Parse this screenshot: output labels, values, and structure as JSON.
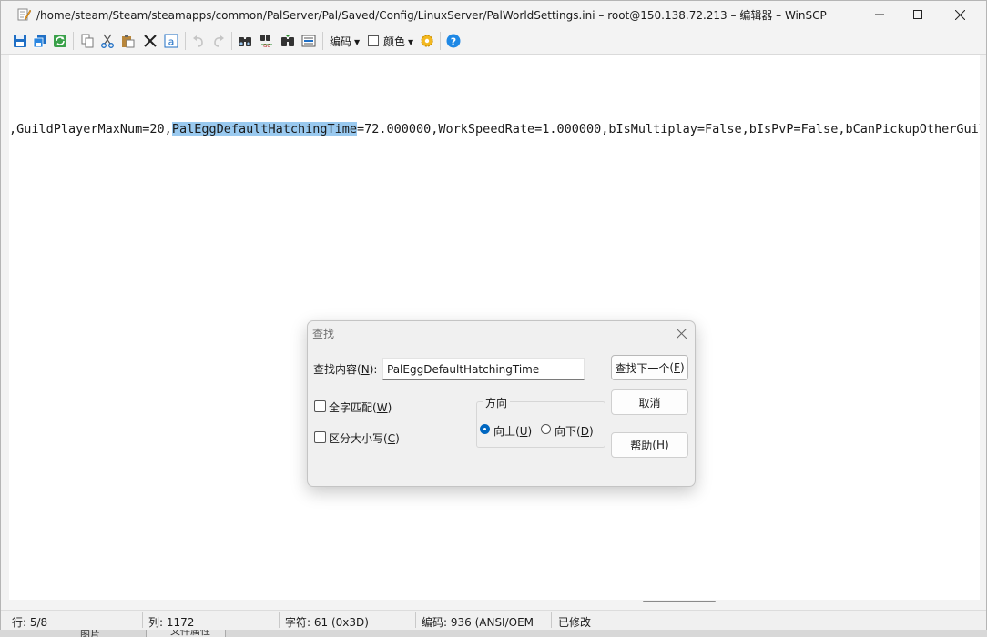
{
  "window": {
    "title": "/home/steam/Steam/steamapps/common/PalServer/Pal/Saved/Config/LinuxServer/PalWorldSettings.ini – root@150.138.72.213 – 编辑器 – WinSCP"
  },
  "toolbar": {
    "encoding_label": "编码",
    "color_label": "颜色"
  },
  "editor": {
    "text_before": ",GuildPlayerMaxNum=20,",
    "text_selected": "PalEggDefaultHatchingTime",
    "text_after": "=72.000000,WorkSpeedRate=1.000000,bIsMultiplay=False,bIsPvP=False,bCanPickupOtherGuildDeathPenaltyDrop"
  },
  "statusbar": {
    "line": "行: 5/8",
    "column": "列: 1172",
    "char": "字符: 61 (0x3D)",
    "encoding": "编码: 936  (ANSI/OEM",
    "modified": "已修改"
  },
  "background": {
    "tab1": "图片",
    "tab2": "文件属性"
  },
  "find_dialog": {
    "title": "查找",
    "find_label": "查找内容",
    "find_accel": "N",
    "find_value": "PalEggDefaultHatchingTime",
    "find_next_label": "查找下一个",
    "find_next_accel": "F",
    "cancel_label": "取消",
    "help_label": "帮助",
    "help_accel": "H",
    "whole_word_label": "全字匹配",
    "whole_word_accel": "W",
    "whole_word_checked": false,
    "case_label": "区分大小写",
    "case_accel": "C",
    "case_checked": false,
    "direction_label": "方向",
    "up_label": "向上",
    "up_accel": "U",
    "down_label": "向下",
    "down_accel": "D",
    "direction_selected": "up"
  },
  "colors": {
    "selection": "#99c9ef",
    "accent": "#0067c0"
  }
}
